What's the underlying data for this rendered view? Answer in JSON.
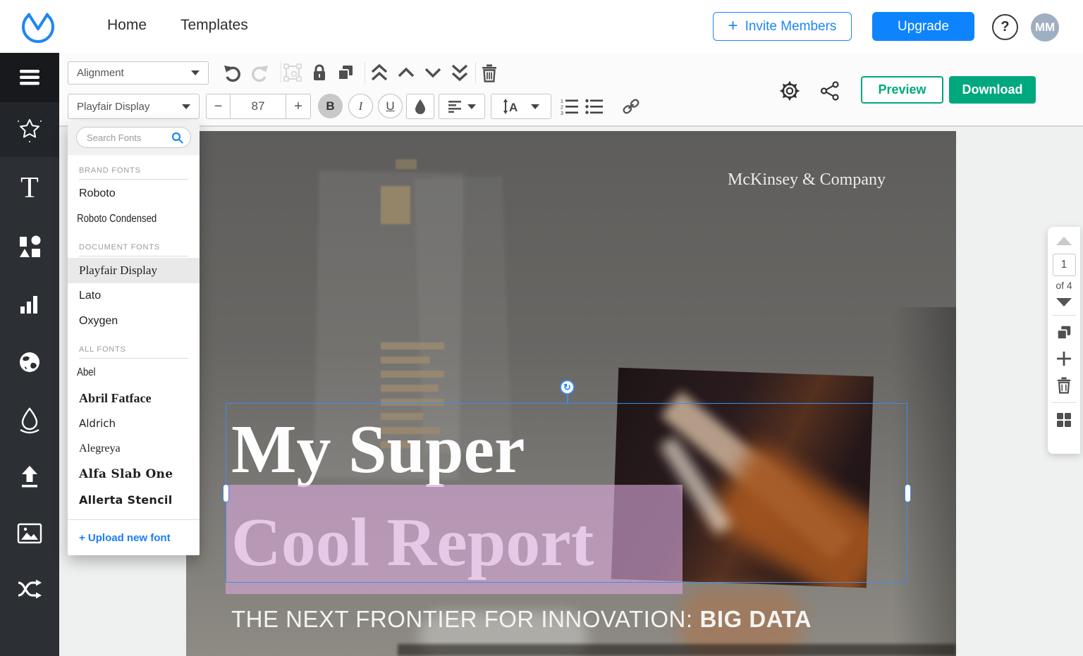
{
  "header": {
    "nav_home": "Home",
    "nav_templates": "Templates",
    "invite_plus": "+",
    "invite_label": "Invite Members",
    "upgrade_label": "Upgrade",
    "help_label": "?",
    "avatar_initials": "MM"
  },
  "toolbar": {
    "alignment_label": "Alignment",
    "font_name": "Playfair Display",
    "font_size": "87",
    "minus_label": "−",
    "plus_label": "+",
    "bold_label": "B",
    "italic_label": "I",
    "underline_label": "U",
    "preview_label": "Preview",
    "download_label": "Download"
  },
  "font_panel": {
    "search_placeholder": "Search Fonts",
    "sections": [
      {
        "label": "BRAND FONTS",
        "fonts": [
          {
            "name": "Roboto"
          },
          {
            "name": "Roboto Condensed"
          }
        ]
      },
      {
        "label": "DOCUMENT FONTS",
        "fonts": [
          {
            "name": "Playfair Display",
            "selected": true
          },
          {
            "name": "Lato"
          },
          {
            "name": "Oxygen"
          }
        ]
      },
      {
        "label": "ALL FONTS",
        "fonts": [
          {
            "name": "Abel"
          },
          {
            "name": "Abril Fatface"
          },
          {
            "name": "Aldrich"
          },
          {
            "name": "Alegreya"
          },
          {
            "name": "Alfa Slab One"
          },
          {
            "name": "Allerta Stencil"
          }
        ]
      }
    ],
    "upload_label": "+ Upload new font"
  },
  "canvas": {
    "brand_text": "McKinsey & Company",
    "title_line1": "My Super",
    "title_line2": "Cool Report",
    "subtitle_regular": "THE NEXT FRONTIER FOR INNOVATION:",
    "subtitle_bold": "BIG DATA"
  },
  "page_controls": {
    "current_page": "1",
    "total_label": "of 4"
  },
  "colors": {
    "accent_blue": "#1d86f5",
    "brand_green": "#00a87e",
    "upgrade_blue": "#0d84fd",
    "selection_highlight_purple": "#d8a8da",
    "avatar_bg": "#9fafc2",
    "sidebar_bg": "#2c3035"
  }
}
